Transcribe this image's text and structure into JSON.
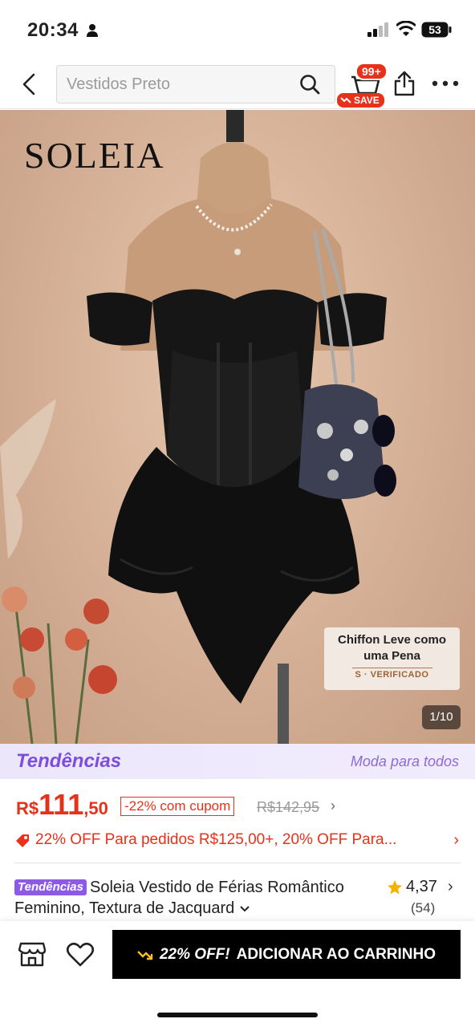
{
  "status_bar": {
    "time": "20:34",
    "battery": "53"
  },
  "header": {
    "search_placeholder": "Vestidos Preto",
    "cart_badge": "99+",
    "save_badge": "SAVE"
  },
  "hero": {
    "brand": "SOLEIA",
    "overlay_line1": "Chiffon Leve como",
    "overlay_line2": "uma Pena",
    "overlay_verified": "S · VERIFICADO",
    "pager": "1/10"
  },
  "trends": {
    "logo": "Tendências",
    "tagline": "Moda para todos"
  },
  "price": {
    "currency": "R$",
    "integer": "111",
    "decimal": ",50",
    "coupon": "-22% com cupom",
    "original": "R$142,95",
    "chevron": "›"
  },
  "promo": {
    "text": "22% OFF Para pedidos R$125,00+,  20% OFF Para...",
    "chevron": "›"
  },
  "product": {
    "badge": "Tendências",
    "title": "Soleia Vestido de Férias Romântico Feminino, Textura de Jacquard",
    "rating": "4,37",
    "reviews": "(54)"
  },
  "bottom": {
    "promo_label": "22% OFF!",
    "add_to_cart": "ADICIONAR AO CARRINHO"
  },
  "colors": {
    "accent": "#e8311a",
    "trend_purple": "#7b4ee0",
    "cta": "#000000"
  }
}
